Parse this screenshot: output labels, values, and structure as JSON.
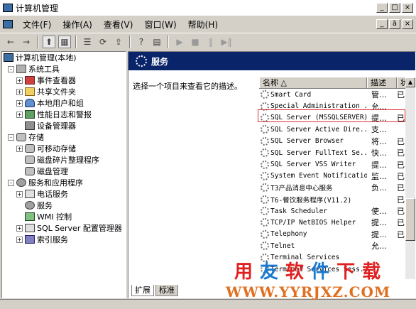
{
  "window": {
    "title": "计算机管理",
    "min": "_",
    "max": "□",
    "close": "×"
  },
  "mdi": {
    "min": "_",
    "max": "ā",
    "close": "×"
  },
  "menu": [
    "文件(F)",
    "操作(A)",
    "查看(V)",
    "窗口(W)",
    "帮助(H)"
  ],
  "toolbar": {
    "back": "←",
    "forward": "→",
    "up": "⬆",
    "show_tree": "▦",
    "properties": "☰",
    "refresh": "⟳",
    "export": "⇪",
    "help": "?",
    "console": "▤",
    "play": "▶",
    "stop": "■",
    "pause": "‖",
    "restart": "▶‖"
  },
  "tree": {
    "root": "计算机管理(本地)",
    "items": [
      {
        "label": "系统工具",
        "exp": "-"
      },
      {
        "label": "事件查看器",
        "exp": "+"
      },
      {
        "label": "共享文件夹",
        "exp": "+"
      },
      {
        "label": "本地用户和组",
        "exp": "+"
      },
      {
        "label": "性能日志和警报",
        "exp": "+"
      },
      {
        "label": "设备管理器",
        "exp": ""
      },
      {
        "label": "存储",
        "exp": "-"
      },
      {
        "label": "可移动存储",
        "exp": "+"
      },
      {
        "label": "磁盘碎片整理程序",
        "exp": ""
      },
      {
        "label": "磁盘管理",
        "exp": ""
      },
      {
        "label": "服务和应用程序",
        "exp": "-"
      },
      {
        "label": "电话服务",
        "exp": "+"
      },
      {
        "label": "服务",
        "exp": ""
      },
      {
        "label": "WMI 控制",
        "exp": ""
      },
      {
        "label": "SQL Server 配置管理器",
        "exp": "+"
      },
      {
        "label": "索引服务",
        "exp": "+"
      }
    ]
  },
  "right": {
    "header": "服务",
    "description": "选择一个项目来查看它的描述。",
    "columns": [
      "名称",
      "描述",
      "状"
    ],
    "sort_arrow": "△",
    "rows": [
      {
        "name": "Smart Card",
        "desc": "管…",
        "status": "已"
      },
      {
        "name": "Special Administration ...",
        "desc": "允…",
        "status": ""
      },
      {
        "name": "SQL Server (MSSQLSERVER)",
        "desc": "提…",
        "status": "已"
      },
      {
        "name": "SQL Server Active Dire...",
        "desc": "支…",
        "status": ""
      },
      {
        "name": "SQL Server Browser",
        "desc": "将…",
        "status": "已"
      },
      {
        "name": "SQL Server FullText Se...",
        "desc": "快…",
        "status": "已"
      },
      {
        "name": "SQL Server VSS Writer",
        "desc": "提…",
        "status": "已"
      },
      {
        "name": "System Event Notification",
        "desc": "监…",
        "status": "已"
      },
      {
        "name": "T3产品消息中心服务",
        "desc": "负…",
        "status": "已"
      },
      {
        "name": "T6-餐饮服务程序(V11.2)",
        "desc": "",
        "status": "已"
      },
      {
        "name": "Task Scheduler",
        "desc": "使…",
        "status": "已"
      },
      {
        "name": "TCP/IP NetBIOS Helper",
        "desc": "提…",
        "status": "已"
      },
      {
        "name": "Telephony",
        "desc": "提…",
        "status": "已"
      },
      {
        "name": "Telnet",
        "desc": "允…",
        "status": ""
      },
      {
        "name": "Terminal Services",
        "desc": "",
        "status": ""
      },
      {
        "name": "Terminal Services Sess...",
        "desc": "",
        "status": ""
      }
    ]
  },
  "tabs": [
    "扩展",
    "标准"
  ],
  "watermark": {
    "line1": [
      "用",
      "友",
      "软",
      "件",
      "下",
      "载"
    ],
    "line2": "WWW.YYRJXZ.COM"
  }
}
